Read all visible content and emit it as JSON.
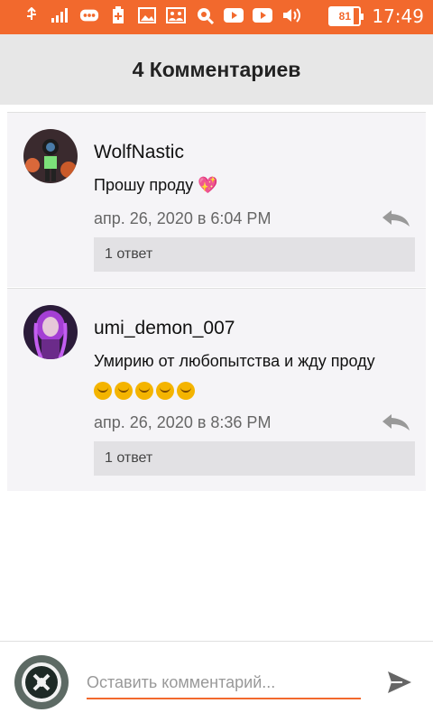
{
  "statusbar": {
    "icons": [
      "usb-icon",
      "signal-icon",
      "chat-icon",
      "battery-plus-icon",
      "image-icon",
      "people-icon",
      "search-icon",
      "youtube-icon",
      "youtube-icon",
      "volume-icon"
    ],
    "battery_level": "81",
    "battery_fraction": 0.81,
    "time": "17:49"
  },
  "header": {
    "title": "4 Комментариев"
  },
  "comments": [
    {
      "author": "WolfNastic",
      "text": "Прошу проду 💖",
      "date": "апр. 26, 2020 в 6:04 PM",
      "replies": "1 ответ"
    },
    {
      "author": "umi_demon_007",
      "text": "Умирию от любопытства и жду проду",
      "emoji_count": 5,
      "date": "апр. 26, 2020 в 8:36 PM",
      "replies": "1 ответ"
    }
  ],
  "composer": {
    "placeholder": "Оставить комментарий..."
  },
  "colors": {
    "accent": "#f2692d",
    "header_bg": "#e7e7e7",
    "card_bg": "#f5f4f7",
    "reply_bg": "#e2e1e4"
  }
}
